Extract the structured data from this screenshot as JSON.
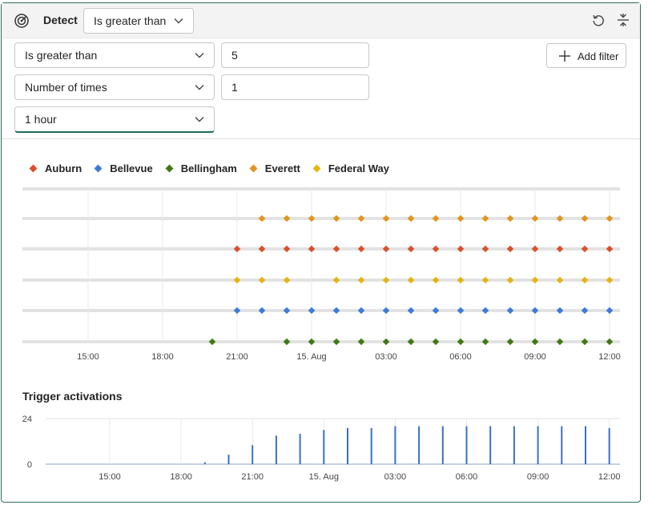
{
  "header": {
    "detect_label": "Detect",
    "detect_select": "Is greater than"
  },
  "filters": {
    "condition_select": "Is greater than",
    "condition_value": "5",
    "count_select": "Number of times",
    "count_value": "1",
    "window_select": "1 hour",
    "add_filter_label": "Add filter"
  },
  "legend": [
    {
      "name": "Auburn",
      "color": "#d9512c"
    },
    {
      "name": "Bellevue",
      "color": "#3d7bd9"
    },
    {
      "name": "Bellingham",
      "color": "#3f7a14"
    },
    {
      "name": "Everett",
      "color": "#e3941b"
    },
    {
      "name": "Federal Way",
      "color": "#e6b410"
    }
  ],
  "trigger_title": "Trigger activations",
  "chart_data": [
    {
      "type": "scatter",
      "title": "",
      "x_tick_labels": [
        "15:00",
        "18:00",
        "21:00",
        "15. Aug",
        "03:00",
        "06:00",
        "09:00",
        "12:00"
      ],
      "x_range_hours": [
        9.0,
        33.0
      ],
      "series": [
        {
          "name": "Everett",
          "lane": 1,
          "color": "#e3941b",
          "x_hours": [
            22,
            23,
            24,
            25,
            26,
            27,
            28,
            29,
            30,
            31,
            32,
            33,
            34,
            35,
            36
          ]
        },
        {
          "name": "Auburn",
          "lane": 2,
          "color": "#d9512c",
          "x_hours": [
            21,
            22,
            23,
            24,
            25,
            26,
            27,
            28,
            29,
            30,
            31,
            32,
            33,
            34,
            35,
            36
          ]
        },
        {
          "name": "Federal Way",
          "lane": 3,
          "color": "#e6b410",
          "x_hours": [
            21,
            22,
            23,
            25,
            26,
            27,
            28,
            29,
            30,
            31,
            32,
            33,
            34,
            35,
            36
          ]
        },
        {
          "name": "Bellevue",
          "lane": 4,
          "color": "#3d7bd9",
          "x_hours": [
            21,
            22,
            23,
            24,
            25,
            26,
            27,
            28,
            29,
            30,
            31,
            32,
            33,
            34,
            35,
            36
          ]
        },
        {
          "name": "Bellingham",
          "lane": 5,
          "color": "#3f7a14",
          "x_hours": [
            20,
            23,
            24,
            25,
            26,
            27,
            28,
            29,
            30,
            31,
            32,
            33,
            34,
            35,
            36
          ]
        }
      ]
    },
    {
      "type": "bar",
      "title": "Trigger activations",
      "x_tick_labels": [
        "15:00",
        "18:00",
        "21:00",
        "15. Aug",
        "03:00",
        "06:00",
        "09:00",
        "12:00"
      ],
      "y_tick_labels": [
        "24",
        "0"
      ],
      "ylim": [
        0,
        24
      ],
      "color": "#3a6fc4",
      "bars": [
        {
          "x_hours": 19.0,
          "value": 1
        },
        {
          "x_hours": 20.0,
          "value": 5
        },
        {
          "x_hours": 21.0,
          "value": 10
        },
        {
          "x_hours": 22.0,
          "value": 15
        },
        {
          "x_hours": 23.0,
          "value": 16
        },
        {
          "x_hours": 24.0,
          "value": 18
        },
        {
          "x_hours": 25.0,
          "value": 19
        },
        {
          "x_hours": 26.0,
          "value": 19
        },
        {
          "x_hours": 27.0,
          "value": 20
        },
        {
          "x_hours": 28.0,
          "value": 20
        },
        {
          "x_hours": 29.0,
          "value": 20
        },
        {
          "x_hours": 30.0,
          "value": 20
        },
        {
          "x_hours": 31.0,
          "value": 20
        },
        {
          "x_hours": 32.0,
          "value": 20
        },
        {
          "x_hours": 33.0,
          "value": 20
        },
        {
          "x_hours": 34.0,
          "value": 20
        },
        {
          "x_hours": 35.0,
          "value": 20
        },
        {
          "x_hours": 36.0,
          "value": 19
        }
      ]
    }
  ]
}
